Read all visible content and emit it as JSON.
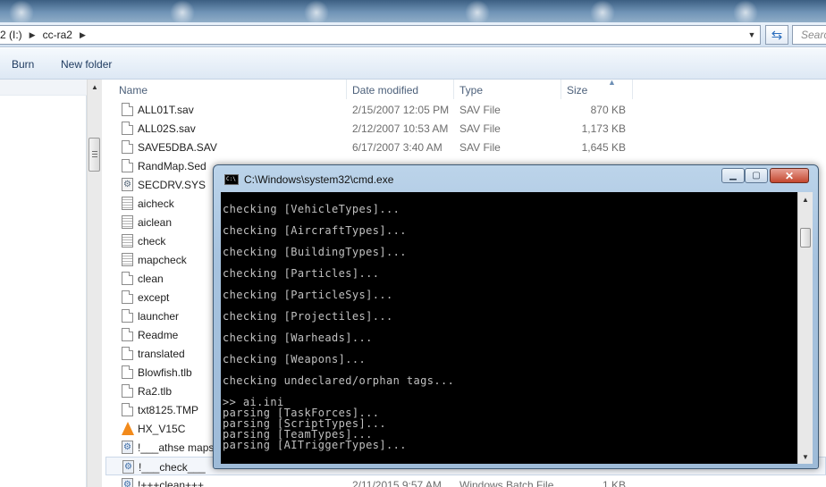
{
  "explorer": {
    "breadcrumb": [
      "2 (I:)",
      "cc-ra2"
    ],
    "search_placeholder": "Search",
    "toolbar": {
      "burn": "Burn",
      "new_folder": "New folder"
    },
    "columns": {
      "name": "Name",
      "date": "Date modified",
      "type": "Type",
      "size": "Size"
    },
    "files": [
      {
        "name": "ALL01T.sav",
        "date": "2/15/2007 12:05 PM",
        "type": "SAV File",
        "size": "870 KB",
        "icon": "file-icon"
      },
      {
        "name": "ALL02S.sav",
        "date": "2/12/2007 10:53 AM",
        "type": "SAV File",
        "size": "1,173 KB",
        "icon": "file-icon"
      },
      {
        "name": "SAVE5DBA.SAV",
        "date": "6/17/2007 3:40 AM",
        "type": "SAV File",
        "size": "1,645 KB",
        "icon": "file-icon"
      },
      {
        "name": "RandMap.Sed",
        "date": "",
        "type": "",
        "size": "",
        "icon": "file-icon"
      },
      {
        "name": "SECDRV.SYS",
        "date": "",
        "type": "",
        "size": "",
        "icon": "system-file-icon"
      },
      {
        "name": "aicheck",
        "date": "",
        "type": "",
        "size": "",
        "icon": "text-file-icon"
      },
      {
        "name": "aiclean",
        "date": "",
        "type": "",
        "size": "",
        "icon": "text-file-icon"
      },
      {
        "name": "check",
        "date": "",
        "type": "",
        "size": "",
        "icon": "text-file-icon"
      },
      {
        "name": "mapcheck",
        "date": "",
        "type": "",
        "size": "",
        "icon": "text-file-icon"
      },
      {
        "name": "clean",
        "date": "",
        "type": "",
        "size": "",
        "icon": "file-icon"
      },
      {
        "name": "except",
        "date": "",
        "type": "",
        "size": "",
        "icon": "file-icon"
      },
      {
        "name": "launcher",
        "date": "",
        "type": "",
        "size": "",
        "icon": "file-icon"
      },
      {
        "name": "Readme",
        "date": "",
        "type": "",
        "size": "",
        "icon": "file-icon"
      },
      {
        "name": "translated",
        "date": "",
        "type": "",
        "size": "",
        "icon": "file-icon"
      },
      {
        "name": "Blowfish.tlb",
        "date": "",
        "type": "",
        "size": "",
        "icon": "file-icon"
      },
      {
        "name": "Ra2.tlb",
        "date": "",
        "type": "",
        "size": "",
        "icon": "file-icon"
      },
      {
        "name": "txt8125.TMP",
        "date": "",
        "type": "",
        "size": "",
        "icon": "file-icon"
      },
      {
        "name": "HX_V15C",
        "date": "",
        "type": "",
        "size": "",
        "icon": "vlc-cone-icon"
      },
      {
        "name": "!___athse maps",
        "date": "",
        "type": "",
        "size": "",
        "icon": "batch-file-icon"
      },
      {
        "name": "!___check___",
        "date": "",
        "type": "",
        "size": "",
        "icon": "batch-file-icon",
        "selected": true
      },
      {
        "name": "!+++clean+++",
        "date": "2/11/2015 9:57 AM",
        "type": "Windows Batch File",
        "size": "1 KB",
        "icon": "batch-file-icon"
      }
    ]
  },
  "cmd": {
    "title": "C:\\Windows\\system32\\cmd.exe",
    "icon_text": "C:\\",
    "lines": [
      "checking [VehicleTypes]...",
      "",
      "checking [AircraftTypes]...",
      "",
      "checking [BuildingTypes]...",
      "",
      "checking [Particles]...",
      "",
      "checking [ParticleSys]...",
      "",
      "checking [Projectiles]...",
      "",
      "checking [Warheads]...",
      "",
      "checking [Weapons]...",
      "",
      "checking undeclared/orphan tags...",
      "",
      ">> ai.ini",
      "parsing [TaskForces]...",
      "parsing [ScriptTypes]...",
      "parsing [TeamTypes]...",
      "parsing [AITriggerTypes]..."
    ]
  }
}
